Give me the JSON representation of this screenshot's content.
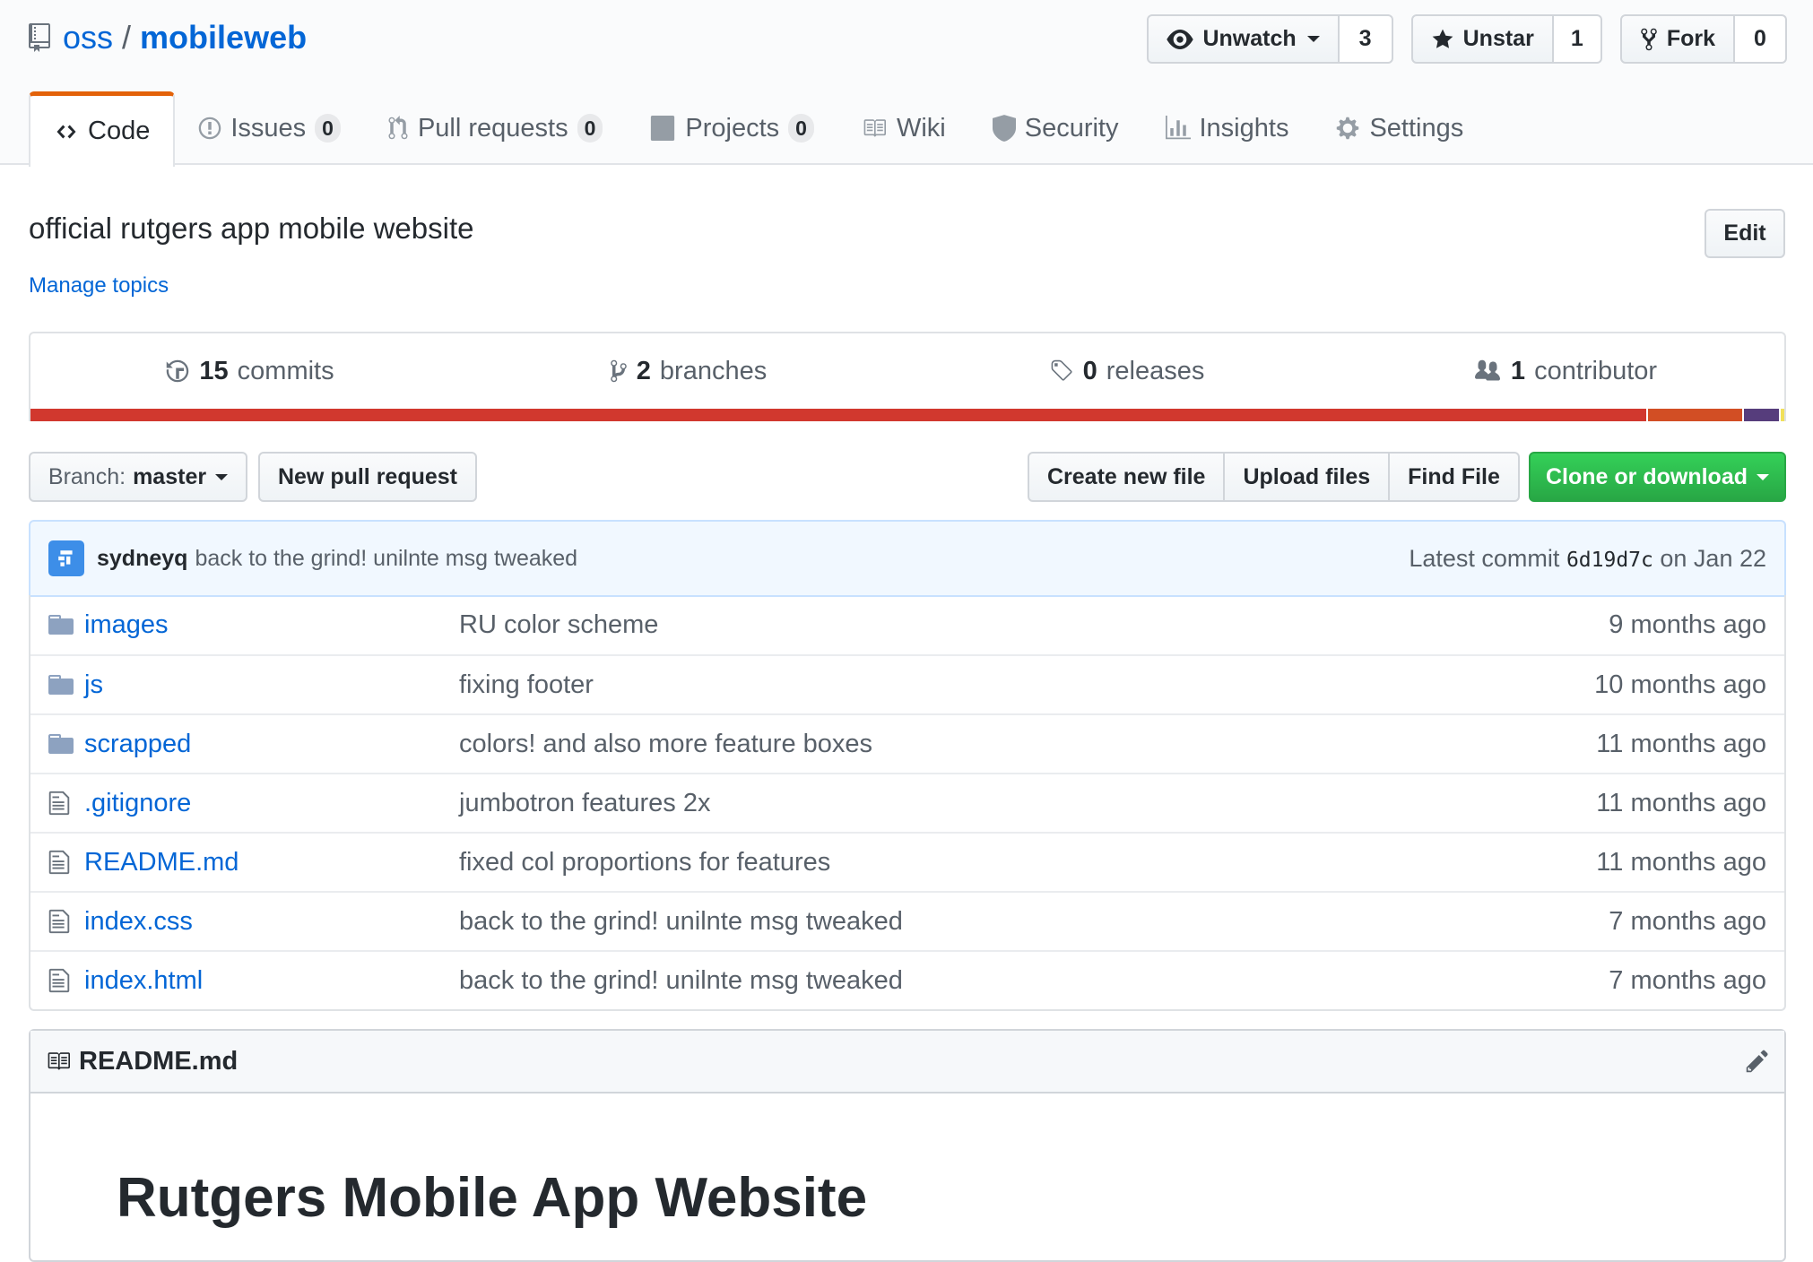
{
  "repo": {
    "owner": "oss",
    "separator": "/",
    "name": "mobileweb"
  },
  "actions": {
    "watch": {
      "label": "Unwatch",
      "count": "3"
    },
    "star": {
      "label": "Unstar",
      "count": "1"
    },
    "fork": {
      "label": "Fork",
      "count": "0"
    }
  },
  "nav": {
    "code": "Code",
    "issues": {
      "label": "Issues",
      "count": "0"
    },
    "pulls": {
      "label": "Pull requests",
      "count": "0"
    },
    "projects": {
      "label": "Projects",
      "count": "0"
    },
    "wiki": "Wiki",
    "security": "Security",
    "insights": "Insights",
    "settings": "Settings"
  },
  "description": "official rutgers app mobile website",
  "manage_topics": "Manage topics",
  "edit_label": "Edit",
  "summary": {
    "commits": {
      "num": "15",
      "label": "commits"
    },
    "branches": {
      "num": "2",
      "label": "branches"
    },
    "releases": {
      "num": "0",
      "label": "releases"
    },
    "contributors": {
      "num": "1",
      "label": "contributor"
    }
  },
  "languages": [
    {
      "color": "#d1382e",
      "percent": 92.4
    },
    {
      "color": "#d24e24",
      "percent": 5.4
    },
    {
      "color": "#563d7c",
      "percent": 2.0
    },
    {
      "color": "#f1e05a",
      "percent": 0.2
    }
  ],
  "file_nav": {
    "branch_prefix": "Branch:",
    "branch_name": "master",
    "new_pr": "New pull request",
    "create_file": "Create new file",
    "upload_files": "Upload files",
    "find_file": "Find File",
    "clone": "Clone or download"
  },
  "latest_commit": {
    "author": "sydneyq",
    "message": "back to the grind! unilnte msg tweaked",
    "prefix": "Latest commit",
    "sha": "6d19d7c",
    "date": "on Jan 22"
  },
  "files": [
    {
      "type": "dir",
      "name": "images",
      "message": "RU color scheme",
      "age": "9 months ago"
    },
    {
      "type": "dir",
      "name": "js",
      "message": "fixing footer",
      "age": "10 months ago"
    },
    {
      "type": "dir",
      "name": "scrapped",
      "message": "colors! and also more feature boxes",
      "age": "11 months ago"
    },
    {
      "type": "file",
      "name": ".gitignore",
      "message": "jumbotron features 2x",
      "age": "11 months ago"
    },
    {
      "type": "file",
      "name": "README.md",
      "message": "fixed col proportions for features",
      "age": "11 months ago"
    },
    {
      "type": "file",
      "name": "index.css",
      "message": "back to the grind! unilnte msg tweaked",
      "age": "7 months ago"
    },
    {
      "type": "file",
      "name": "index.html",
      "message": "back to the grind! unilnte msg tweaked",
      "age": "7 months ago"
    }
  ],
  "readme": {
    "filename": "README.md",
    "heading": "Rutgers Mobile App Website"
  }
}
